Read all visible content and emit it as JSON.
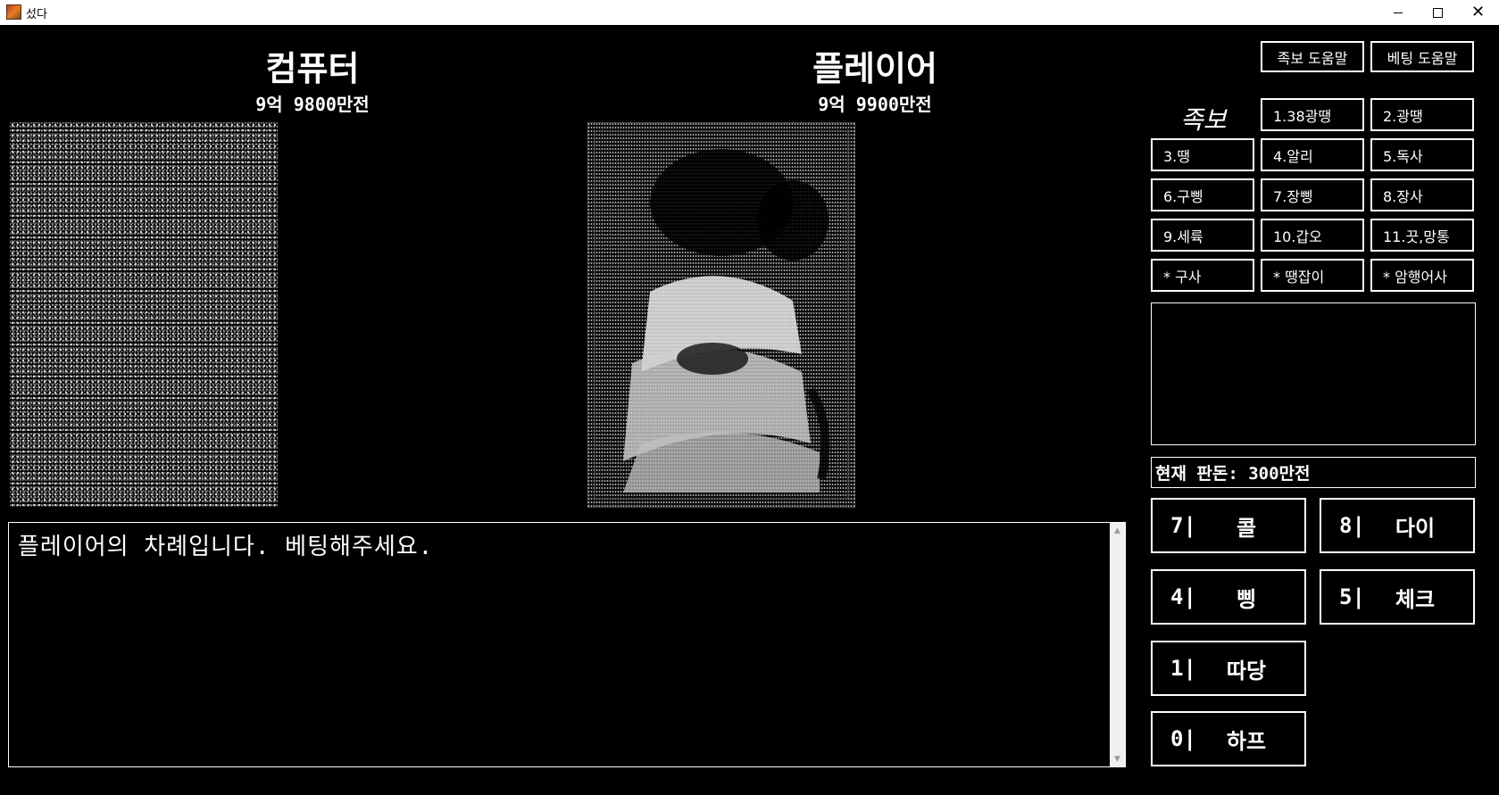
{
  "window": {
    "title": "섰다",
    "minimize": "",
    "maximize": "",
    "close": "✕"
  },
  "computer": {
    "name": "컴퓨터",
    "money": "9억 9800만전"
  },
  "player": {
    "name": "플레이어",
    "money": "9억 9900만전"
  },
  "help": {
    "jokbo": "족보 도움말",
    "betting": "베팅 도움말"
  },
  "jokbo": {
    "label": "족보",
    "items": [
      "1.38광땡",
      "2.광땡",
      "3.땡",
      "4.알리",
      "5.독사",
      "6.구삥",
      "7.장삥",
      "8.장사",
      "9.세륙",
      "10.갑오",
      "11.끗,망통",
      "* 구사",
      "* 땡잡이",
      "* 암행어사"
    ]
  },
  "pot": "현재 판돈: 300만전",
  "bets": [
    {
      "key": "7|",
      "label": "콜"
    },
    {
      "key": "8|",
      "label": "다이"
    },
    {
      "key": "4|",
      "label": "삥"
    },
    {
      "key": "5|",
      "label": "체크"
    },
    {
      "key": "1|",
      "label": "따당"
    },
    {
      "key": "0|",
      "label": "하프"
    }
  ],
  "log": {
    "text": "플레이어의 차례입니다. 베팅해주세요."
  },
  "scroll": {
    "up": "▲",
    "down": "▼"
  }
}
